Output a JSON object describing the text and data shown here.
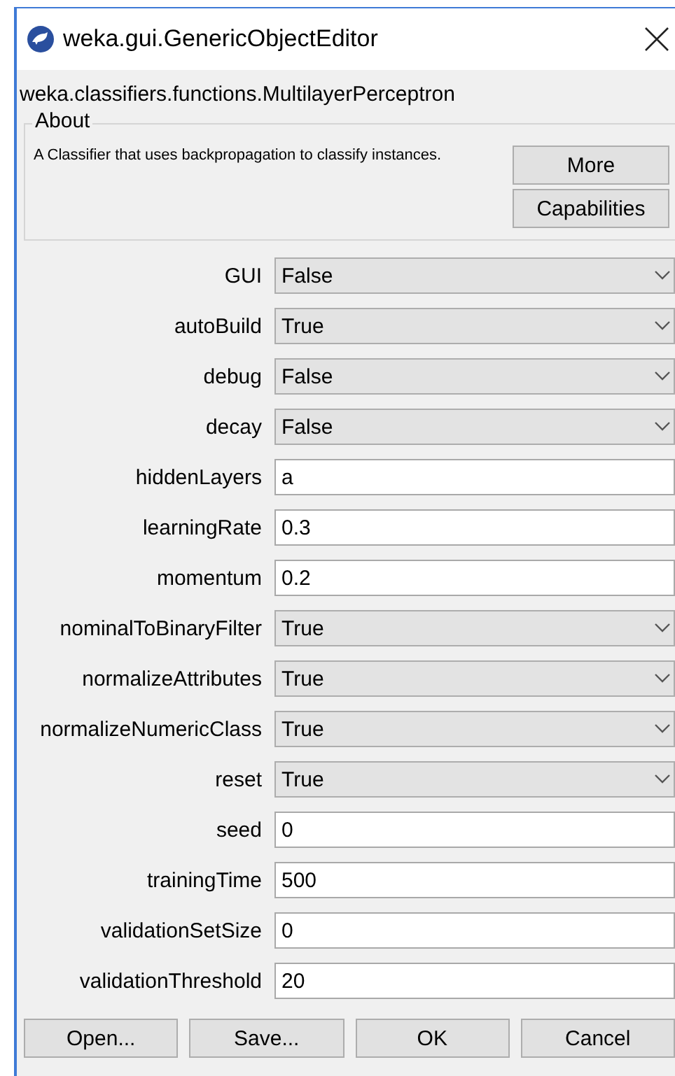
{
  "window": {
    "title": "weka.gui.GenericObjectEditor"
  },
  "class_name": "weka.classifiers.functions.MultilayerPerceptron",
  "about": {
    "legend": "About",
    "text": "A Classifier that uses backpropagation to classify instances.",
    "buttons": [
      "More",
      "Capabilities"
    ]
  },
  "properties": [
    {
      "label": "GUI",
      "kind": "select",
      "value": "False"
    },
    {
      "label": "autoBuild",
      "kind": "select",
      "value": "True"
    },
    {
      "label": "debug",
      "kind": "select",
      "value": "False"
    },
    {
      "label": "decay",
      "kind": "select",
      "value": "False"
    },
    {
      "label": "hiddenLayers",
      "kind": "text",
      "value": "a"
    },
    {
      "label": "learningRate",
      "kind": "text",
      "value": "0.3"
    },
    {
      "label": "momentum",
      "kind": "text",
      "value": "0.2"
    },
    {
      "label": "nominalToBinaryFilter",
      "kind": "select",
      "value": "True"
    },
    {
      "label": "normalizeAttributes",
      "kind": "select",
      "value": "True"
    },
    {
      "label": "normalizeNumericClass",
      "kind": "select",
      "value": "True"
    },
    {
      "label": "reset",
      "kind": "select",
      "value": "True"
    },
    {
      "label": "seed",
      "kind": "text",
      "value": "0"
    },
    {
      "label": "trainingTime",
      "kind": "text",
      "value": "500"
    },
    {
      "label": "validationSetSize",
      "kind": "text",
      "value": "0"
    },
    {
      "label": "validationThreshold",
      "kind": "text",
      "value": "20"
    }
  ],
  "buttons": [
    "Open...",
    "Save...",
    "OK",
    "Cancel"
  ]
}
